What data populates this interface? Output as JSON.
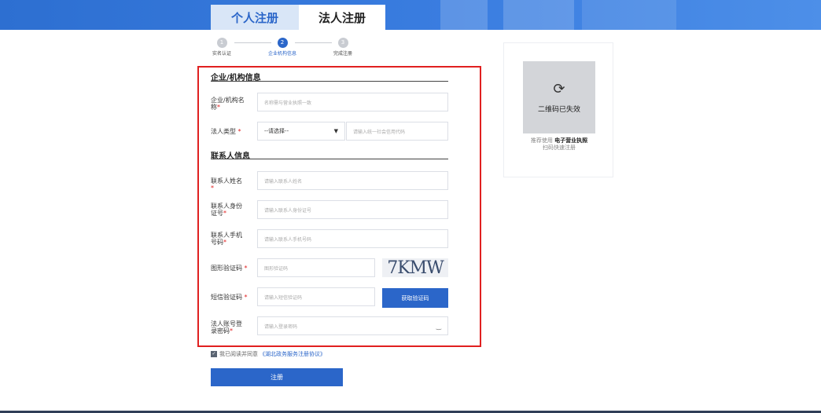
{
  "tabs": {
    "personal": "个人注册",
    "legal": "法人注册"
  },
  "steps": [
    {
      "num": "1",
      "label": "实名认证"
    },
    {
      "num": "2",
      "label": "企业机构信息"
    },
    {
      "num": "3",
      "label": "完成注册"
    }
  ],
  "sections": {
    "org": "企业/机构信息",
    "contact": "联系人信息"
  },
  "fields": {
    "org_name": {
      "label": "企业/机构名称",
      "placeholder": "名称需与营业执照一致"
    },
    "legal_type": {
      "label": "法人类型",
      "selected": "--请选择--",
      "code_placeholder": "请输入统一社会信用代码"
    },
    "contact_name": {
      "label": "联系人姓名",
      "placeholder": "请输入联系人姓名"
    },
    "contact_id": {
      "label": "联系人身份证号",
      "placeholder": "请输入联系人身份证号"
    },
    "contact_phone": {
      "label": "联系人手机号码",
      "placeholder": "请输入联系人手机号码"
    },
    "captcha": {
      "label": "图形验证码",
      "placeholder": "图形验证码",
      "image_text": "7KMW"
    },
    "sms": {
      "label": "短信验证码",
      "placeholder": "请输入短信验证码",
      "button": "获取验证码"
    },
    "password": {
      "label": "法人账号登录密码",
      "placeholder": "请输入登录密码"
    }
  },
  "agree": {
    "text": "我已阅读并同意",
    "link": "《湖北政务服务注册协议》"
  },
  "submit_label": "注册",
  "qr": {
    "expired": "二维码已失效",
    "tip_prefix": "推荐使用",
    "tip_bold": "电子营业执照",
    "tip_line2": "扫码快速注册"
  },
  "required_mark": "*",
  "colors": {
    "primary": "#2b66c9",
    "highlight_frame": "#e02020"
  }
}
